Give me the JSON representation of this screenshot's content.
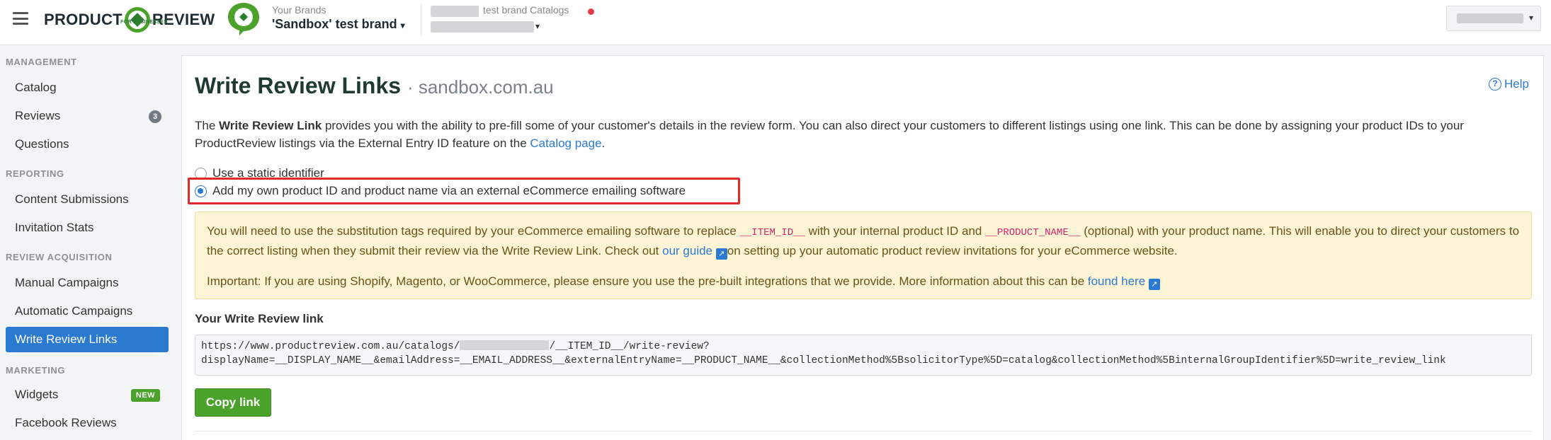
{
  "header": {
    "logo_left": "PRODUCT",
    "logo_right": "REVIEW",
    "logo_sub": "FOR BUSINESSES",
    "brands_label": "Your Brands",
    "brand_name": "'Sandbox' test brand",
    "catalogs_label": "test brand Catalogs"
  },
  "sidebar": {
    "sections": [
      {
        "title": "MANAGEMENT",
        "items": [
          {
            "label": "Catalog"
          },
          {
            "label": "Reviews",
            "badge": "3"
          },
          {
            "label": "Questions"
          }
        ]
      },
      {
        "title": "REPORTING",
        "items": [
          {
            "label": "Content Submissions"
          },
          {
            "label": "Invitation Stats"
          }
        ]
      },
      {
        "title": "REVIEW ACQUISITION",
        "items": [
          {
            "label": "Manual Campaigns"
          },
          {
            "label": "Automatic Campaigns"
          },
          {
            "label": "Write Review Links",
            "active": true
          }
        ]
      },
      {
        "title": "MARKETING",
        "items": [
          {
            "label": "Widgets",
            "badge": "NEW"
          },
          {
            "label": "Facebook Reviews"
          }
        ]
      }
    ]
  },
  "main": {
    "title": "Write Review Links",
    "title_domain": "· sandbox.com.au",
    "help_label": "Help",
    "intro": {
      "part1": "The ",
      "bold": "Write Review Link",
      "part2": " provides you with the ability to pre-fill some of your customer's details in the review form. You can also direct your customers to different listings using one link. This can be done by assigning your product IDs to your ProductReview listings via the External Entry ID feature on the ",
      "link": "Catalog page",
      "part3": "."
    },
    "radio_options": [
      {
        "label": "Use a static identifier",
        "checked": false
      },
      {
        "label": "Add my own product ID and product name via an external eCommerce emailing software",
        "checked": true
      }
    ],
    "notice": {
      "p1_a": "You will need to use the substitution tags required by your eCommerce emailing software to replace ",
      "tag1": "__ITEM_ID__",
      "p1_b": " with your internal product ID and ",
      "tag2": "__PRODUCT_NAME__",
      "p1_c": " (optional) with your product name. This will enable you to direct your customers to the correct listing when they submit their review via the Write Review Link. Check out ",
      "guide_link": "our guide",
      "p1_d": "on setting up your automatic product review invitations for your eCommerce website.",
      "p2_a": "Important: If you are using Shopify, Magento, or WooCommerce, please ensure you use the pre-built integrations that we provide. More information about this can be ",
      "found_link": "found here"
    },
    "link_section_label": "Your Write Review link",
    "link_line1_a": "https://www.productreview.com.au/catalogs/",
    "link_line1_b": "/__ITEM_ID__/write-review?",
    "link_line2": "displayName=__DISPLAY_NAME__&emailAddress=__EMAIL_ADDRESS__&externalEntryName=__PRODUCT_NAME__&collectionMethod%5BsolicitorType%5D=catalog&collectionMethod%5BinternalGroupIdentifier%5D=write_review_link",
    "copy_button": "Copy link"
  }
}
